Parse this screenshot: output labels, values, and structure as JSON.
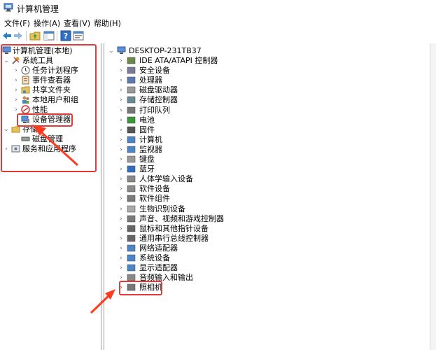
{
  "window": {
    "title": "计算机管理"
  },
  "menu": [
    "文件(F)",
    "操作(A)",
    "查看(V)",
    "帮助(H)"
  ],
  "toolbar_icons": [
    "back-arrow-icon",
    "forward-arrow-icon",
    "folder-up-icon",
    "show-hide-tree-icon",
    "help-icon",
    "properties-icon"
  ],
  "left_tree": {
    "root": "计算机管理(本地)",
    "system_tools": "系统工具",
    "task_scheduler": "任务计划程序",
    "event_viewer": "事件查看器",
    "shared_folders": "共享文件夹",
    "local_users": "本地用户和组",
    "performance": "性能",
    "device_manager": "设备管理器",
    "storage": "存储",
    "disk_management": "磁盘管理",
    "services_apps": "服务和应用程序"
  },
  "right_tree": {
    "root": "DESKTOP-231TB37",
    "categories": [
      "IDE ATA/ATAPI 控制器",
      "安全设备",
      "处理器",
      "磁盘驱动器",
      "存储控制器",
      "打印队列",
      "电池",
      "固件",
      "计算机",
      "监视器",
      "键盘",
      "蓝牙",
      "人体学输入设备",
      "软件设备",
      "软件组件",
      "生物识别设备",
      "声音、视频和游戏控制器",
      "鼠标和其他指针设备",
      "通用串行总线控制器",
      "网络适配器",
      "系统设备",
      "显示适配器",
      "音频输入和输出",
      "照相机"
    ]
  },
  "accent_colors": {
    "highlight": "#e53935",
    "arrow": "#ff3b1f"
  }
}
